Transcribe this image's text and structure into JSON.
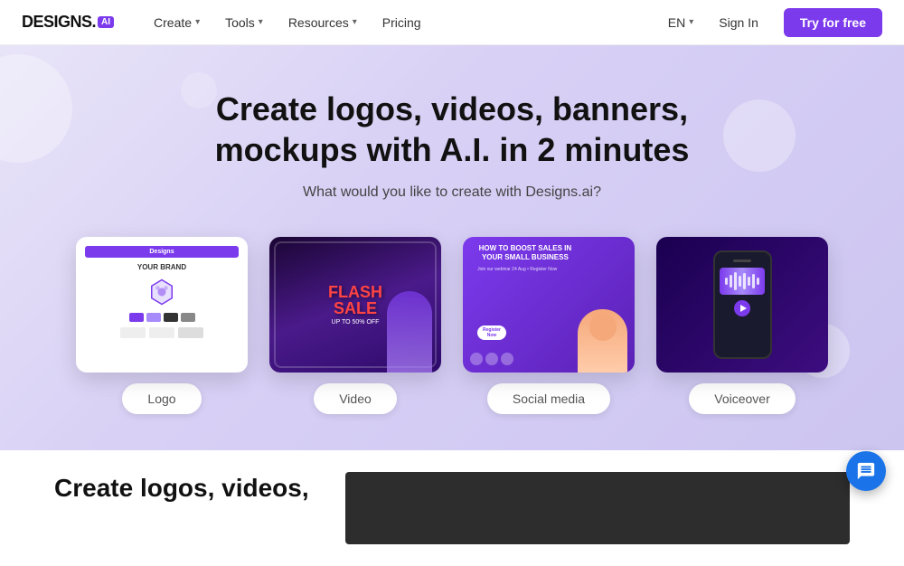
{
  "logo": {
    "text": "DESIGNS.",
    "ai": "AI"
  },
  "nav": {
    "create_label": "Create",
    "tools_label": "Tools",
    "resources_label": "Resources",
    "pricing_label": "Pricing",
    "lang_label": "EN",
    "sign_in_label": "Sign In",
    "try_free_label": "Try for free"
  },
  "hero": {
    "title": "Create logos, videos, banners, mockups with A.I. in 2 minutes",
    "subtitle": "What would you like to create with Designs.ai?"
  },
  "cards": [
    {
      "id": "logo",
      "label": "Logo",
      "brand_text": "YOUR BRAND"
    },
    {
      "id": "video",
      "label": "Video",
      "flash_text": "FLASH\nSALE"
    },
    {
      "id": "social",
      "label": "Social media",
      "card_title": "HOW TO BOOST SALES IN YOUR SMALL BUSINESS"
    },
    {
      "id": "voiceover",
      "label": "Voiceover"
    }
  ],
  "bottom": {
    "title": "Create logos, videos,"
  },
  "colors": {
    "purple": "#7c3aed",
    "brand_blue": "#1a73e8"
  }
}
